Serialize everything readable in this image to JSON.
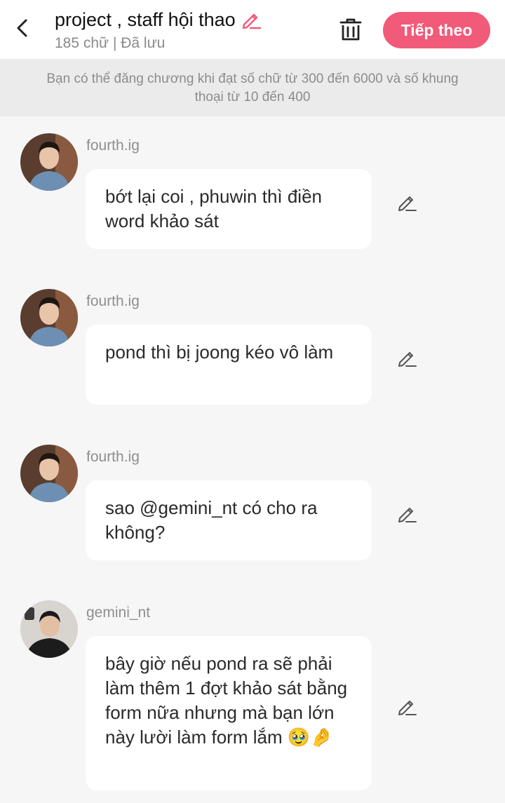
{
  "header": {
    "title": "project , staff hội thao",
    "subtitle": "185 chữ | Đã lưu",
    "next_label": "Tiếp theo",
    "accent": "#f15a78"
  },
  "notice": {
    "text": "Bạn có thể đăng chương khi đạt số chữ từ 300 đến 6000 và số khung thoại từ 10 đến 400"
  },
  "messages": [
    {
      "username": "fourth.ig",
      "text": "bớt lại coi , phuwin thì điền word khảo sát"
    },
    {
      "username": "fourth.ig",
      "text": "pond thì bị joong kéo vô làm"
    },
    {
      "username": "fourth.ig",
      "text": "sao @gemini_nt có cho ra không?"
    },
    {
      "username": "gemini_nt",
      "text": "bây giờ nếu pond ra sẽ phải làm thêm 1 đợt khảo sát bằng form nữa nhưng mà bạn lớn này lười làm form lắm 🥹🤌"
    }
  ],
  "icons": {
    "back": "back-arrow-icon",
    "title_edit": "pencil-icon",
    "trash": "trash-icon",
    "edit": "pencil-icon"
  }
}
